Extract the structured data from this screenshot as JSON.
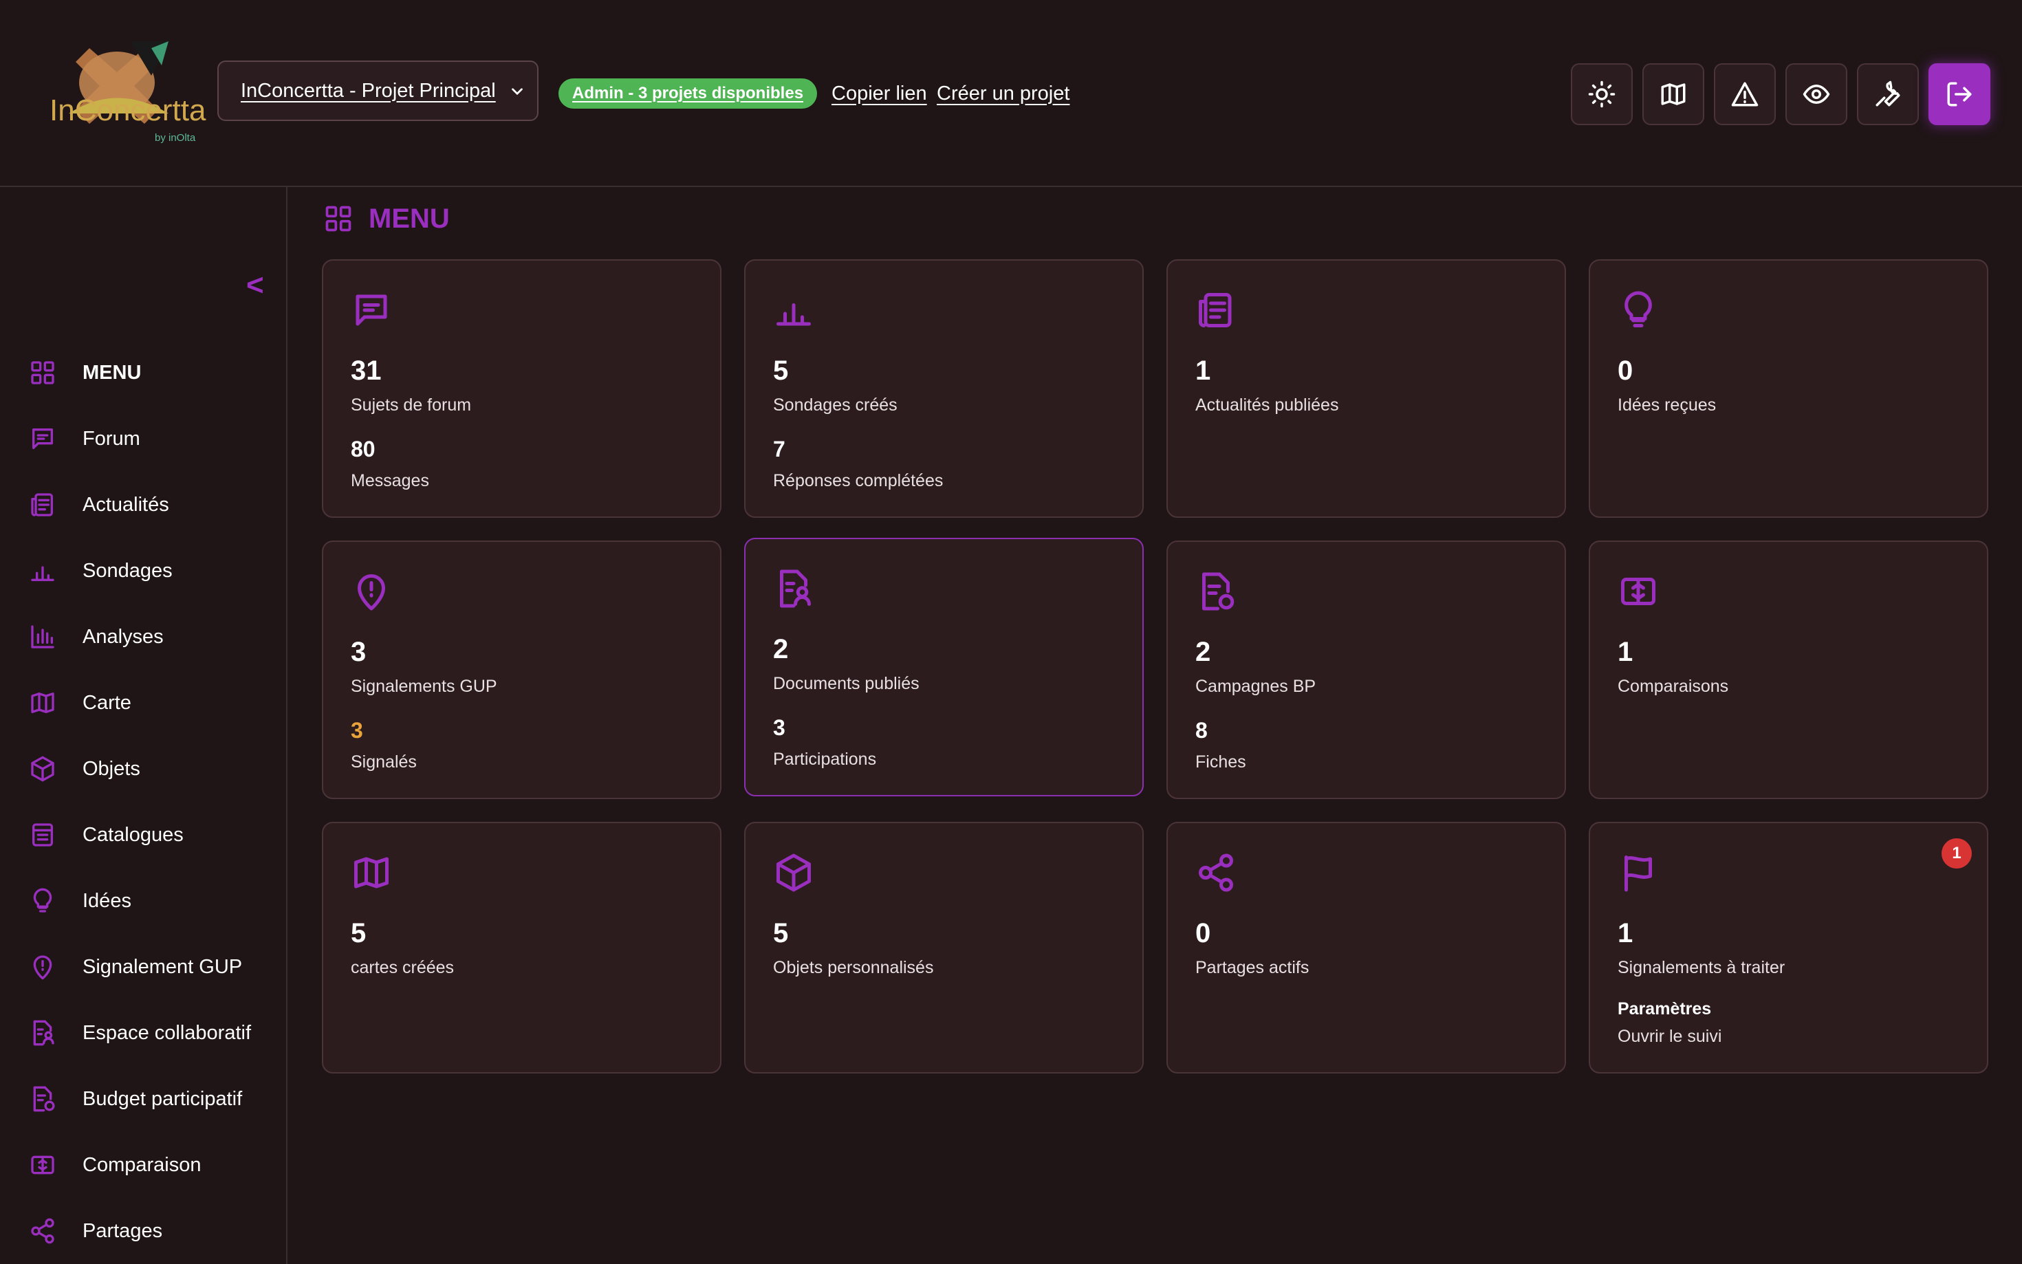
{
  "header": {
    "project_select": "InConcertta - Projet Principal",
    "admin_badge": "Admin - 3 projets disponibles",
    "copy_link": "Copier lien",
    "create_project": "Créer un projet",
    "buttons": [
      "sun-icon",
      "map-icon",
      "alert-triangle-icon",
      "eye-icon",
      "wrench-icon",
      "logout-icon"
    ]
  },
  "logo": {
    "text": "InConcertta",
    "byline": "by inOlta"
  },
  "sidebar": {
    "collapse": "<",
    "items": [
      {
        "label": "MENU",
        "icon": "grid-icon"
      },
      {
        "label": "Forum",
        "icon": "message-icon"
      },
      {
        "label": "Actualités",
        "icon": "newspaper-icon"
      },
      {
        "label": "Sondages",
        "icon": "bar-chart-icon"
      },
      {
        "label": "Analyses",
        "icon": "analytics-icon"
      },
      {
        "label": "Carte",
        "icon": "map-icon"
      },
      {
        "label": "Objets",
        "icon": "cube-icon"
      },
      {
        "label": "Catalogues",
        "icon": "catalog-icon"
      },
      {
        "label": "Idées",
        "icon": "lightbulb-icon"
      },
      {
        "label": "Signalement GUP",
        "icon": "map-pin-alert-icon"
      },
      {
        "label": "Espace collaboratif",
        "icon": "doc-user-icon"
      },
      {
        "label": "Budget participatif",
        "icon": "doc-badge-icon"
      },
      {
        "label": "Comparaison",
        "icon": "compare-icon"
      },
      {
        "label": "Partages",
        "icon": "share-icon"
      }
    ]
  },
  "main": {
    "title": "MENU",
    "cards": [
      {
        "value": "31",
        "label": "Sujets de forum",
        "value2": "80",
        "label2": "Messages",
        "icon": "message-icon"
      },
      {
        "value": "5",
        "label": "Sondages créés",
        "value2": "7",
        "label2": "Réponses complétées",
        "icon": "bar-chart-icon"
      },
      {
        "value": "1",
        "label": "Actualités publiées",
        "icon": "newspaper-icon"
      },
      {
        "value": "0",
        "label": "Idées reçues",
        "icon": "lightbulb-icon"
      },
      {
        "value": "3",
        "label": "Signalements GUP",
        "value2": "3",
        "label2": "Signalés",
        "icon": "map-pin-alert-icon"
      },
      {
        "value": "2",
        "label": "Documents publiés",
        "value2": "3",
        "label2": "Participations",
        "icon": "doc-user-icon"
      },
      {
        "value": "2",
        "label": "Campagnes BP",
        "value2": "8",
        "label2": "Fiches",
        "icon": "doc-badge-icon"
      },
      {
        "value": "1",
        "label": "Comparaisons",
        "icon": "compare-icon"
      },
      {
        "value": "5",
        "label": "cartes créées",
        "icon": "map-icon"
      },
      {
        "value": "5",
        "label": "Objets personnalisés",
        "icon": "cube-icon"
      },
      {
        "value": "0",
        "label": "Partages actifs",
        "icon": "share-icon"
      },
      {
        "value": "1",
        "label": "Signalements à traiter",
        "sub_title": "Paramètres",
        "sub_text": "Ouvrir le suivi",
        "badge": "1",
        "icon": "flag-icon"
      }
    ]
  },
  "colors": {
    "accent": "#9a2fbf",
    "background": "#1f1517",
    "card": "#2d1c1e",
    "success": "#4fb453",
    "warning": "#e8a33a",
    "danger": "#d93434"
  }
}
